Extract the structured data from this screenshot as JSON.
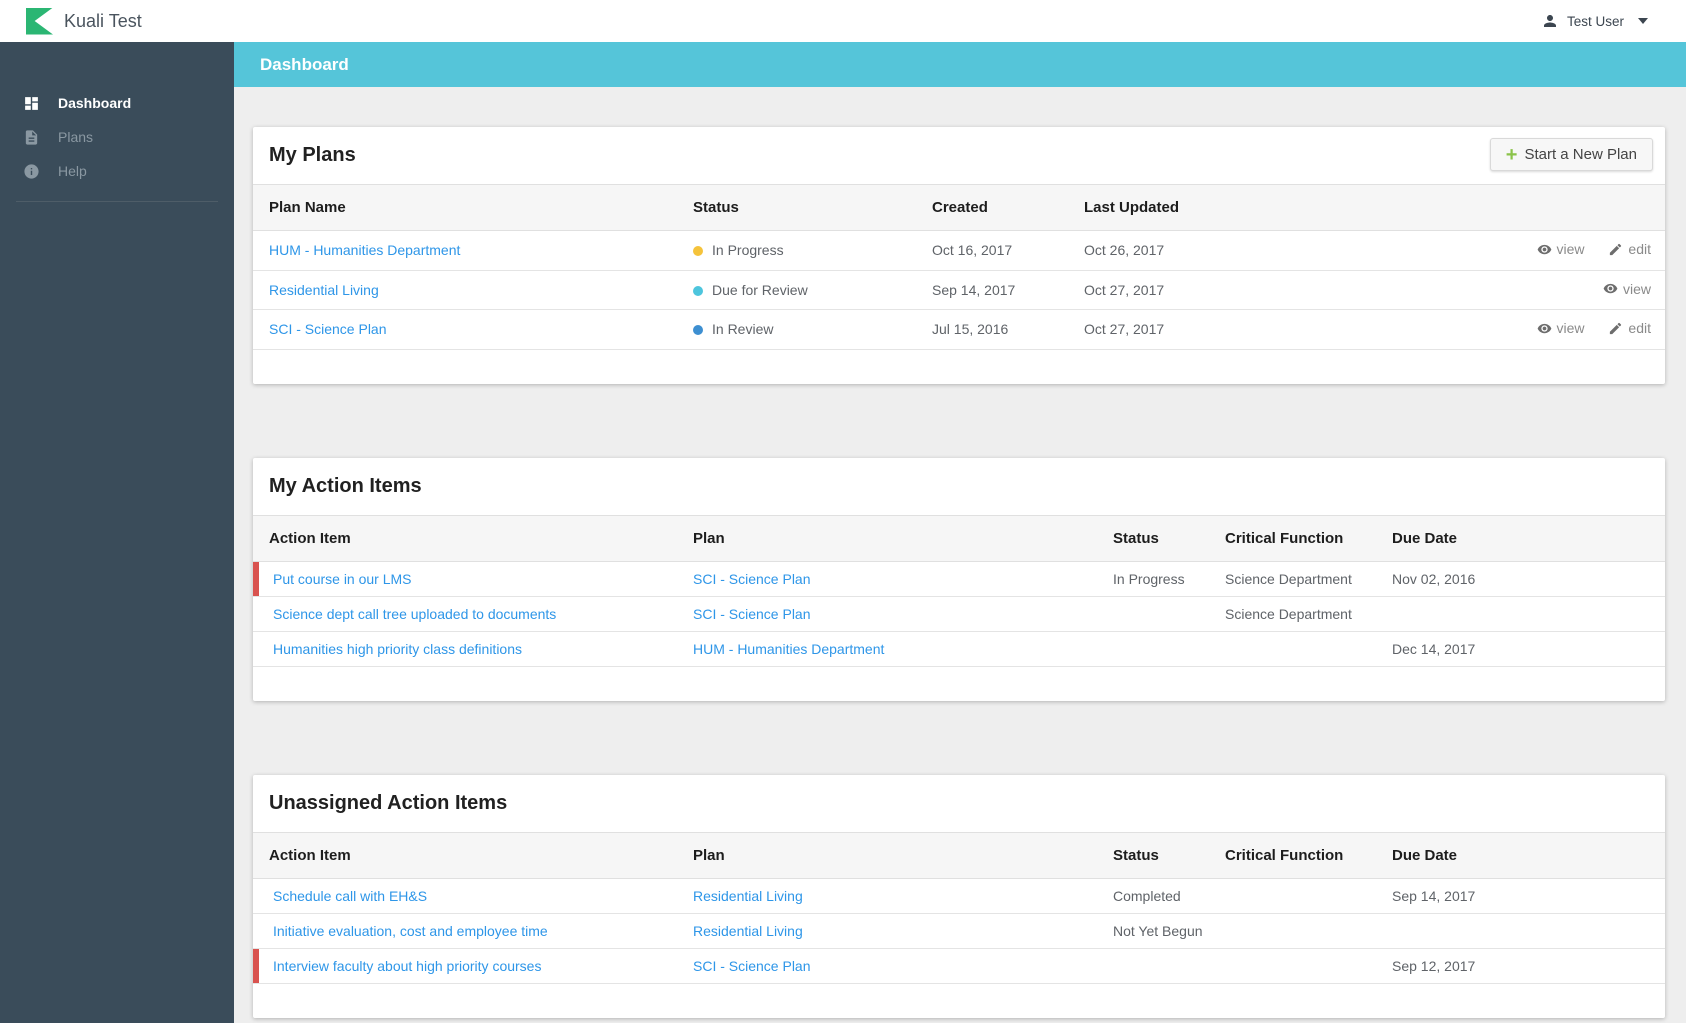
{
  "app": {
    "brand": "Kuali Test",
    "user": "Test User"
  },
  "banner": {
    "title": "Dashboard"
  },
  "sidebar": {
    "items": [
      {
        "label": "Dashboard",
        "icon": "dashboard-icon",
        "active": true
      },
      {
        "label": "Plans",
        "icon": "plans-document-icon",
        "active": false
      },
      {
        "label": "Help",
        "icon": "help-info-icon",
        "active": false
      }
    ]
  },
  "colors": {
    "banner_cyan": "#55C5D9",
    "sidebar_dark": "#3A4C5A",
    "brand_green": "#2BB673",
    "link_blue": "#2E96E8",
    "overdue_red": "#D9534F",
    "plus_green": "#8BC34A"
  },
  "my_plans": {
    "title": "My Plans",
    "new_plan_button": "Start a New Plan",
    "columns": {
      "name": "Plan Name",
      "status": "Status",
      "created": "Created",
      "updated": "Last Updated"
    },
    "action_labels": {
      "view": "view",
      "edit": "edit"
    },
    "rows": [
      {
        "name": "HUM - Humanities Department",
        "status": "In Progress",
        "status_color": "#F5C33B",
        "created": "Oct 16, 2017",
        "updated": "Oct 26, 2017"
      },
      {
        "name": "Residential Living",
        "status": "Due for Review",
        "status_color": "#4DC5DD",
        "created": "Sep 14, 2017",
        "updated": "Oct 27, 2017"
      },
      {
        "name": "SCI - Science Plan",
        "status": "In Review",
        "status_color": "#3D8FD1",
        "created": "Jul 15, 2016",
        "updated": "Oct 27, 2017"
      }
    ]
  },
  "action_columns": {
    "action": "Action Item",
    "plan": "Plan",
    "status": "Status",
    "critical": "Critical Function",
    "due": "Due Date"
  },
  "my_action_items": {
    "title": "My Action Items",
    "rows": [
      {
        "action": "Put course in our LMS",
        "plan": "SCI - Science Plan",
        "status": "In Progress",
        "critical": "Science Department",
        "due": "Nov 02, 2016",
        "overdue": true
      },
      {
        "action": "Science dept call tree uploaded to documents",
        "plan": "SCI - Science Plan",
        "status": "",
        "critical": "Science Department",
        "due": "",
        "overdue": false
      },
      {
        "action": "Humanities high priority class definitions",
        "plan": "HUM - Humanities Department",
        "status": "",
        "critical": "",
        "due": "Dec 14, 2017",
        "overdue": false
      }
    ]
  },
  "unassigned_action_items": {
    "title": "Unassigned Action Items",
    "rows": [
      {
        "action": "Schedule call with EH&S",
        "plan": "Residential Living",
        "status": "Completed",
        "critical": "",
        "due": "Sep 14, 2017",
        "overdue": false
      },
      {
        "action": "Initiative evaluation, cost and employee time",
        "plan": "Residential Living",
        "status": "Not Yet Begun",
        "critical": "",
        "due": "",
        "overdue": false
      },
      {
        "action": "Interview faculty about high priority courses",
        "plan": "SCI - Science Plan",
        "status": "",
        "critical": "",
        "due": "Sep 12, 2017",
        "overdue": true
      }
    ]
  }
}
